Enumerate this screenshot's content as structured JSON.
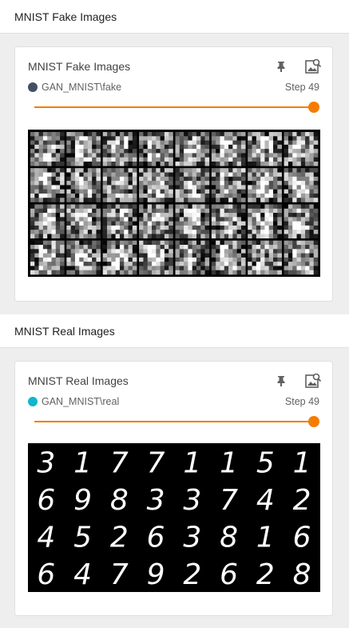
{
  "colors": {
    "accent": "#f57c00",
    "fake_run": "#425066",
    "real_run": "#12b5cb"
  },
  "groups": [
    {
      "header": "MNIST Fake Images",
      "card": {
        "title": "MNIST Fake Images",
        "run": "GAN_MNIST\\fake",
        "step": "Step 49",
        "slider_position": 1.0,
        "image_grid": {
          "rows": 4,
          "cols": 8,
          "kind": "noisy-generated-samples"
        }
      }
    },
    {
      "header": "MNIST Real Images",
      "card": {
        "title": "MNIST Real Images",
        "run": "GAN_MNIST\\real",
        "step": "Step 49",
        "slider_position": 1.0,
        "image_grid": {
          "rows": 4,
          "cols": 8,
          "kind": "handwritten-digits",
          "digits": [
            [
              "3",
              "1",
              "7",
              "7",
              "1",
              "1",
              "5",
              "1"
            ],
            [
              "6",
              "9",
              "8",
              "3",
              "3",
              "7",
              "4",
              "2"
            ],
            [
              "4",
              "5",
              "2",
              "6",
              "3",
              "8",
              "1",
              "6"
            ],
            [
              "6",
              "4",
              "7",
              "9",
              "2",
              "6",
              "2",
              "8"
            ]
          ]
        }
      }
    }
  ],
  "icons": {
    "pin": "pin-icon",
    "image_search": "image-search-icon"
  }
}
